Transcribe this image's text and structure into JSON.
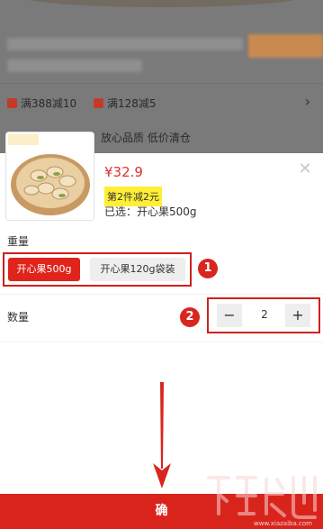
{
  "background": {
    "promo_1": "满388减10",
    "promo_2": "满128减5",
    "slogan": "放心品质 低价清仓"
  },
  "product": {
    "price": "¥32.9",
    "promo_badge": "第2件减2元",
    "selected_text": "已选：开心果500g"
  },
  "weight": {
    "label": "重量",
    "options": [
      "开心果500g",
      "开心果120g袋装"
    ],
    "selected_index": 0
  },
  "quantity": {
    "label": "数量",
    "minus": "−",
    "value": "2",
    "plus": "+"
  },
  "annotations": {
    "badge_1": "1",
    "badge_2": "2"
  },
  "footer": {
    "confirm_label": "确"
  },
  "watermark": {
    "url": "www.xiazaiba.com"
  },
  "colors": {
    "accent": "#e0241b",
    "promo_yellow": "#ffee34",
    "overlay": "#7a7a7a"
  }
}
